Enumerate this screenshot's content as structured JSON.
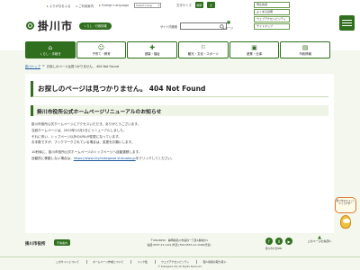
{
  "topbar": {
    "links": [
      "ふりがなをふる",
      "ご利用案内",
      "Foreign Language"
    ],
    "language_select": "Select Lang",
    "font_label": "文字サイズ",
    "font_buttons": [
      "標準",
      "大"
    ],
    "right_links": [
      "緊急情報",
      "よくある質問",
      "ウェブアクセシビリティ",
      "サイトマップ"
    ]
  },
  "header": {
    "logo_text": "掛川市",
    "life_badge": "くらし・行政情報",
    "search_label": "サイト内検索",
    "walk_label": "ページ"
  },
  "nav": [
    {
      "icon": "⌂",
      "label": "くらし・手続き"
    },
    {
      "icon": "☺",
      "label": "子育て・教育"
    },
    {
      "icon": "✚",
      "label": "健康・福祉"
    },
    {
      "icon": "⚐",
      "label": "観光・文化・スポーツ"
    },
    {
      "icon": "▣",
      "label": "産業・仕事"
    },
    {
      "icon": "▤",
      "label": "市政情報"
    }
  ],
  "breadcrumb": {
    "home": "掛川トップ",
    "current": "お探しのページは見つかりません。 404 Not Found"
  },
  "main": {
    "page_title": "お探しのページは見つかりません。 404 Not Found",
    "section_title": "掛川市役所公式ホームページリニューアルのお知らせ",
    "lines": [
      "掛川市役所公式ホームページにアクセスいただき、ありがとうございます。",
      "当該ホームページは、2025年12月1日にリニューアルしました。",
      "それに伴い、トップページ以外のURLが変更になっています。",
      "お手数ですが、ブックマークされている場合は、変更をお願いします。"
    ],
    "redirect_line": "10秒後に、掛川市役所公式ホームページのトップページへ自動遷移します。",
    "manual_prefix": "自動的に移動しない場合は、",
    "manual_link": "https://www.city.kakegawa.shizuoka.jp",
    "manual_suffix": "をクリックしてください。"
  },
  "footer": {
    "name": "掛川市役所",
    "map_button": "庁舎案内",
    "address_lines": [
      "〒436-8650　静岡県掛川市長谷一丁目1番地の1",
      "電話:0537-21-1111(代表)  FAX:0537-21-1166(代表)"
    ],
    "social_label": "掛川市公式SNS",
    "social_icons": [
      "f",
      "X",
      "▶"
    ],
    "pagetop": "このページの先頭へ",
    "mascot_text": "掛川市マスコットキャラクター",
    "links": [
      "このサイトについて",
      "ホームページ作成について",
      "リンク集",
      "ウェブアクセシビリティ",
      "個人情報の取り扱い"
    ],
    "copyright": "© Kakegawa City All Rights Reserved."
  }
}
